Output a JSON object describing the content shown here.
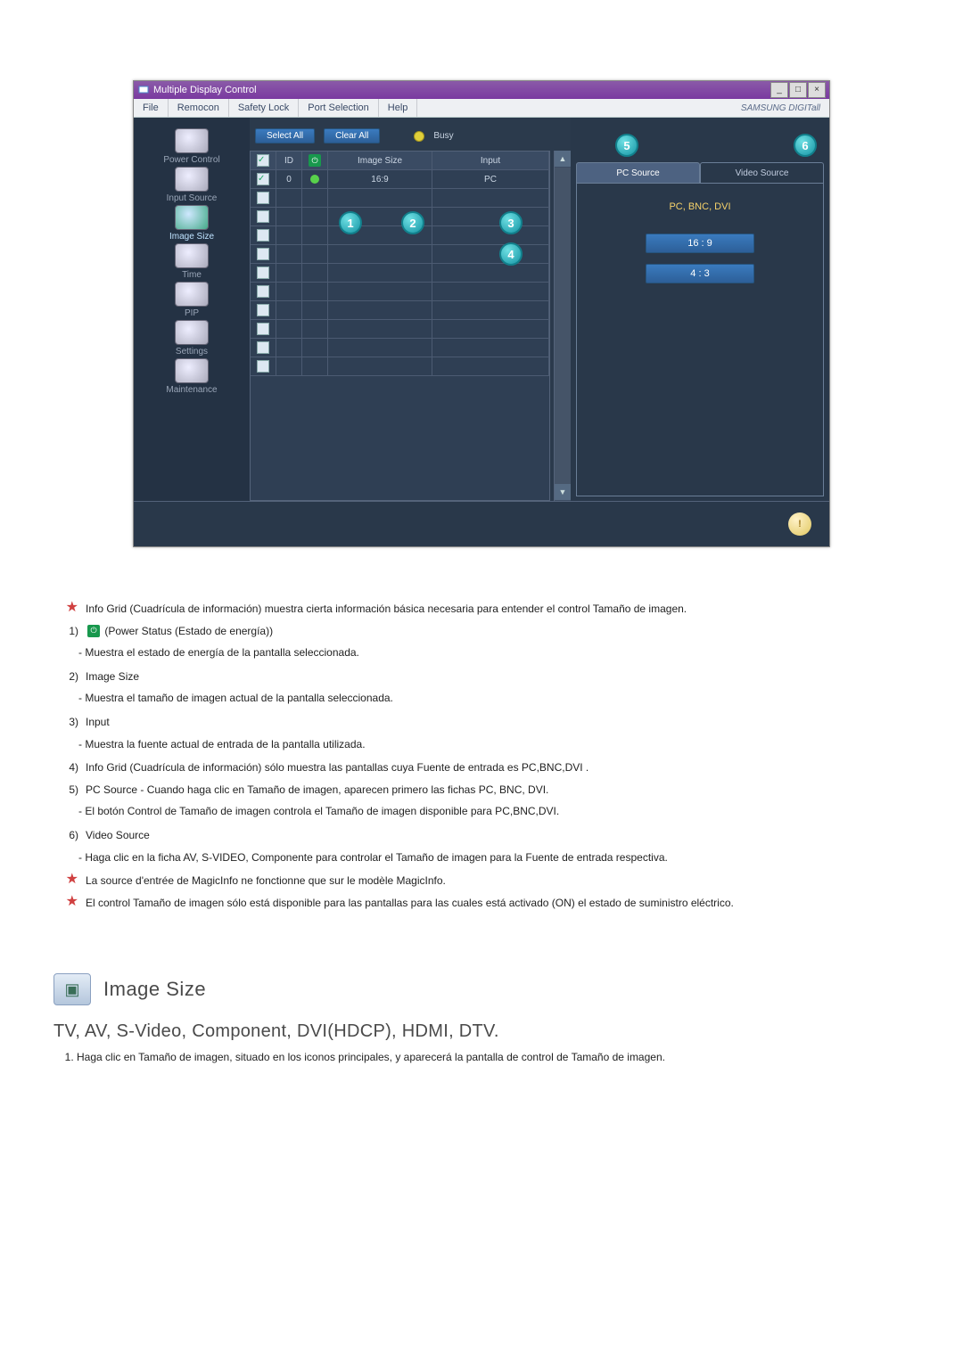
{
  "app": {
    "title": "Multiple Display Control",
    "menu": [
      "File",
      "Remocon",
      "Safety Lock",
      "Port Selection",
      "Help"
    ],
    "brand": "SAMSUNG DIGITall",
    "sidebar": [
      {
        "label": "Power Control",
        "active": false
      },
      {
        "label": "Input Source",
        "active": false
      },
      {
        "label": "Image Size",
        "active": true
      },
      {
        "label": "Time",
        "active": false
      },
      {
        "label": "PIP",
        "active": false
      },
      {
        "label": "Settings",
        "active": false
      },
      {
        "label": "Maintenance",
        "active": false
      }
    ],
    "toolbar": {
      "select_all": "Select All",
      "clear_all": "Clear All",
      "busy": "Busy"
    },
    "grid": {
      "headers": {
        "id": "ID",
        "size": "Image Size",
        "input": "Input"
      },
      "rows": [
        {
          "checked": true,
          "id": "0",
          "power": "on",
          "size": "16:9",
          "input": "PC"
        },
        {
          "checked": false,
          "id": "",
          "power": "",
          "size": "",
          "input": ""
        },
        {
          "checked": false,
          "id": "",
          "power": "",
          "size": "",
          "input": ""
        },
        {
          "checked": false,
          "id": "",
          "power": "",
          "size": "",
          "input": ""
        },
        {
          "checked": false,
          "id": "",
          "power": "",
          "size": "",
          "input": ""
        },
        {
          "checked": false,
          "id": "",
          "power": "",
          "size": "",
          "input": ""
        },
        {
          "checked": false,
          "id": "",
          "power": "",
          "size": "",
          "input": ""
        },
        {
          "checked": false,
          "id": "",
          "power": "",
          "size": "",
          "input": ""
        },
        {
          "checked": false,
          "id": "",
          "power": "",
          "size": "",
          "input": ""
        },
        {
          "checked": false,
          "id": "",
          "power": "",
          "size": "",
          "input": ""
        },
        {
          "checked": false,
          "id": "",
          "power": "",
          "size": "",
          "input": ""
        }
      ]
    },
    "right": {
      "tabs": {
        "pc": "PC Source",
        "video": "Video Source"
      },
      "header": "PC, BNC, DVI",
      "options": [
        "16 : 9",
        "4 : 3"
      ]
    },
    "callouts": {
      "c1": "1",
      "c2": "2",
      "c3": "3",
      "c4": "4",
      "c5": "5",
      "c6": "6"
    }
  },
  "doc": {
    "intro": "Info Grid (Cuadrícula de información) muestra cierta información básica necesaria para entender el control Tamaño de imagen.",
    "items": {
      "n1_label": "1)",
      "n1_text": " (Power Status (Estado de energía))",
      "n1_sub": "- Muestra el estado de energía de la pantalla seleccionada.",
      "n2_label": "2)",
      "n2_title": "Image Size",
      "n2_sub": "- Muestra el tamaño de imagen actual de la pantalla seleccionada.",
      "n3_label": "3)",
      "n3_title": "Input",
      "n3_sub": "- Muestra la fuente actual de entrada de la pantalla utilizada.",
      "n4_label": "4)",
      "n4_text": "Info Grid (Cuadrícula de información) sólo muestra las pantallas cuya Fuente de entrada es PC,BNC,DVI .",
      "n5_label": "5)",
      "n5_text": "PC Source - Cuando haga clic en Tamaño de imagen, aparecen primero las fichas PC, BNC, DVI.",
      "n5_sub": "- El botón Control de Tamaño de imagen controla el Tamaño de imagen disponible para PC,BNC,DVI.",
      "n6_label": "6)",
      "n6_title": "Video Source",
      "n6_sub": "- Haga clic en la ficha AV, S-VIDEO, Componente para controlar el Tamaño de imagen para la Fuente de entrada respectiva.",
      "note1": "La source d'entrée de MagicInfo ne fonctionne que sur le modèle MagicInfo.",
      "note2": "El control Tamaño de imagen sólo está disponible para las pantallas para las cuales está activado (ON) el estado de suministro eléctrico."
    },
    "section_title": "Image Size",
    "sub_heading": "TV, AV, S-Video, Component, DVI(HDCP), HDMI, DTV.",
    "steps": {
      "s1": "Haga clic en Tamaño de imagen, situado en los iconos principales, y aparecerá la pantalla de control de Tamaño de imagen."
    }
  }
}
